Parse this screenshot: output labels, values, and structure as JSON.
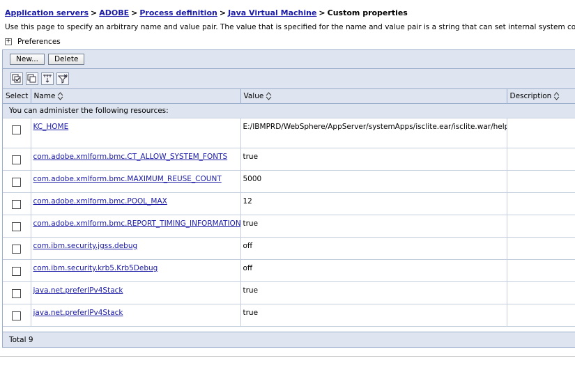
{
  "breadcrumb": {
    "items": [
      "Application servers",
      "ADOBE",
      "Process definition",
      "Java Virtual Machine"
    ],
    "current": "Custom properties",
    "sep": ">"
  },
  "description": "Use this page to specify an arbitrary name and value pair. The value that is specified for the name and value pair is a string that can set internal system configura",
  "preferences": {
    "toggle": "+",
    "label": "Preferences"
  },
  "buttons": {
    "new": "New...",
    "delete": "Delete"
  },
  "icons": [
    "select-all-icon",
    "deselect-all-icon",
    "show-filter-icon",
    "clear-filter-icon"
  ],
  "table": {
    "headers": {
      "select": "Select",
      "name": "Name",
      "value": "Value",
      "description": "Description"
    },
    "resources_msg": "You can administer the following resources:",
    "rows": [
      {
        "name": "KC_HOME",
        "value": "E:/IBMPRD/WebSphere/AppServer/systemApps/isclite.ear/isclite.war/help",
        "description": ""
      },
      {
        "name": "com.adobe.xmlform.bmc.CT_ALLOW_SYSTEM_FONTS",
        "value": "true",
        "description": ""
      },
      {
        "name": "com.adobe.xmlform.bmc.MAXIMUM_REUSE_COUNT",
        "value": "5000",
        "description": ""
      },
      {
        "name": "com.adobe.xmlform.bmc.POOL_MAX",
        "value": "12",
        "description": ""
      },
      {
        "name": "com.adobe.xmlform.bmc.REPORT_TIMING_INFORMATION",
        "value": "true",
        "description": ""
      },
      {
        "name": "com.ibm.security.jgss.debug",
        "value": "off",
        "description": ""
      },
      {
        "name": "com.ibm.security.krb5.Krb5Debug",
        "value": "off",
        "description": ""
      },
      {
        "name": "java.net.preferIPv4Stack",
        "value": "true",
        "description": ""
      },
      {
        "name": "java.net.preferIPv4Stack",
        "value": "true",
        "description": ""
      }
    ],
    "total": "Total 9"
  }
}
